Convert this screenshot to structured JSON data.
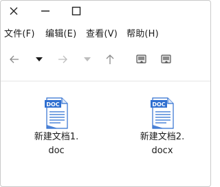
{
  "window": {
    "controls": {
      "close": "close-icon",
      "minimize": "minimize-icon",
      "maximize": "maximize-icon"
    }
  },
  "menubar": {
    "file": "文件(F)",
    "edit": "编辑(E)",
    "view": "查看(V)",
    "help": "帮助(H)"
  },
  "toolbar": {
    "back": "arrow-left-icon",
    "back_history": "caret-down-icon",
    "forward": "arrow-right-icon",
    "forward_history": "caret-down-icon",
    "up": "arrow-up-icon",
    "view_toggle_1": "view-mode-icon",
    "view_toggle_2": "view-mode-icon"
  },
  "files": [
    {
      "name_line1": "新建文档1.",
      "name_line2": "doc",
      "icon_label": "DOC"
    },
    {
      "name_line1": "新建文档2.",
      "name_line2": "docx",
      "icon_label": "DOC"
    }
  ],
  "colors": {
    "doc_icon_blue": "#2f6fd0",
    "disabled_gray": "#b5b5b5",
    "text": "#1a1a1a"
  }
}
